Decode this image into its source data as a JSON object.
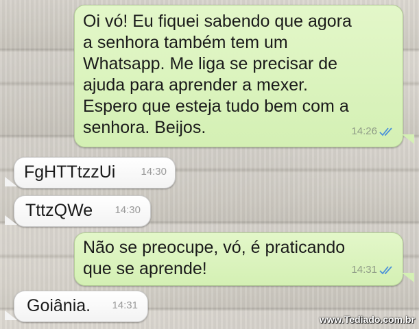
{
  "conversation": {
    "messages": [
      {
        "direction": "outgoing",
        "text": "Oi vó! Eu fiquei sabendo que agora\na senhora também tem um\nWhatsapp. Me liga se precisar de\najuda para aprender a mexer.\nEspero que esteja tudo bem com a\nsenhora. Beijos.",
        "time": "14:26",
        "status_icon": "double-check-icon"
      },
      {
        "direction": "incoming",
        "text": "FgHTTtzzUi",
        "time": "14:30"
      },
      {
        "direction": "incoming",
        "text": "TttzQWe",
        "time": "14:30"
      },
      {
        "direction": "outgoing",
        "text": "Não se preocupe, vó, é praticando\nque se aprende!",
        "time": "14:31",
        "status_icon": "double-check-icon"
      },
      {
        "direction": "incoming",
        "text": "Goiânia.",
        "time": "14:31"
      }
    ]
  },
  "watermark": {
    "text": "www.Tediado.com.br"
  },
  "colors": {
    "outgoing_bubble": "#d4f0b4",
    "incoming_bubble": "#ffffff",
    "read_ticks": "#4a90d9"
  }
}
